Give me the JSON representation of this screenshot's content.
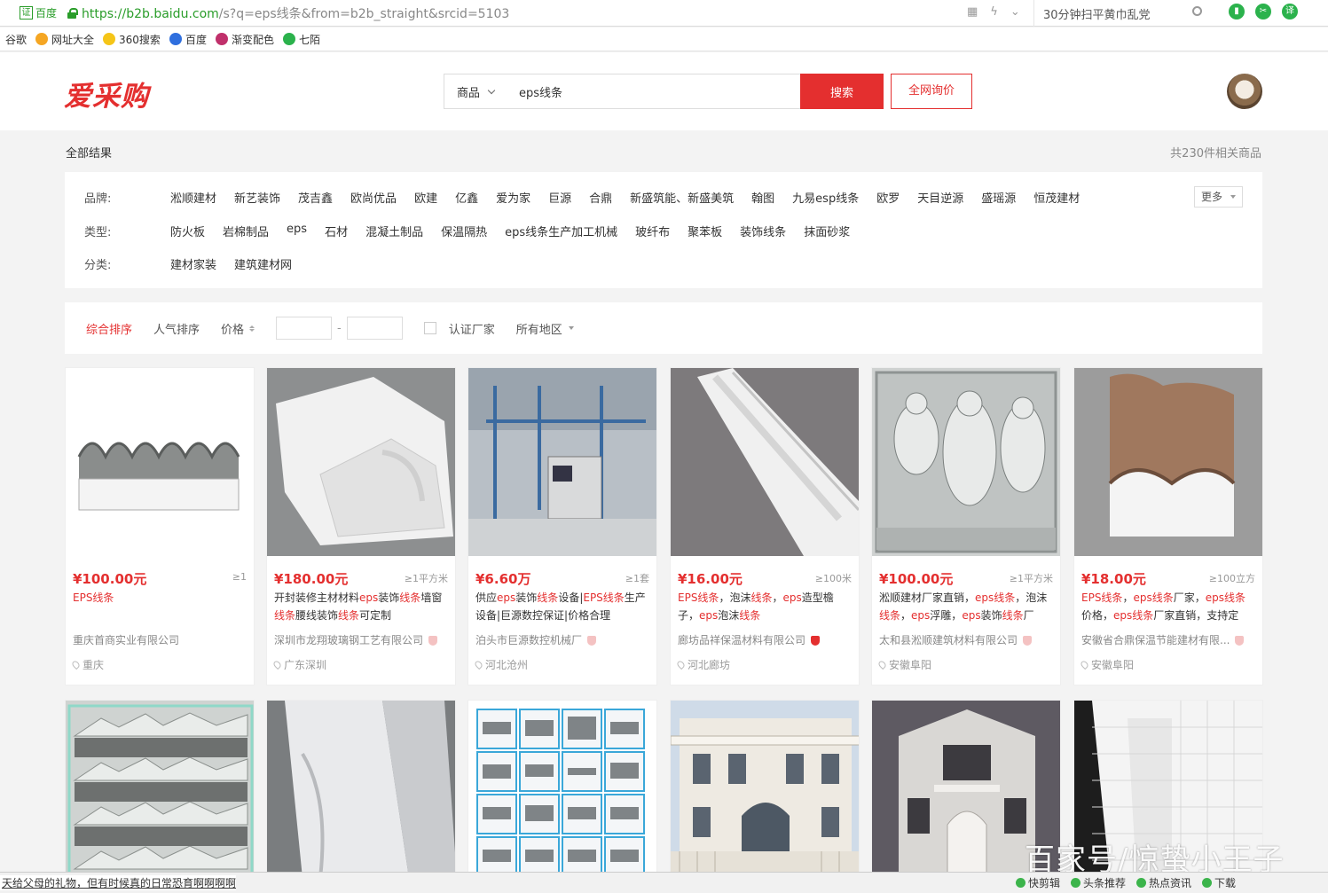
{
  "browser": {
    "cert_label": "百度",
    "cert_mark": "证",
    "url_domain": "https://b2b.baidu.com",
    "url_rest": "/s?q=eps线条&from=b2b_straight&srcid=5103",
    "addr_search_text": "30分钟扫平黄巾乱党",
    "chrome_icons": [
      "grid-icon",
      "bolt-icon",
      "chevron-down-icon"
    ],
    "ext_icons": [
      {
        "name": "reader-ext-icon",
        "color": "#2bb24c",
        "glyph": "▮"
      },
      {
        "name": "scissors-ext-icon",
        "color": "#2bb24c",
        "glyph": "✂"
      },
      {
        "name": "translate-ext-icon",
        "color": "#2bb24c",
        "glyph": "译"
      }
    ],
    "bookmarks": [
      {
        "label": "谷歌",
        "icon": "",
        "color": ""
      },
      {
        "label": "网址大全",
        "icon": "wangzhi-icon",
        "color": "#f5a623"
      },
      {
        "label": "360搜索",
        "icon": "360-icon",
        "color": "#f5c518"
      },
      {
        "label": "百度",
        "icon": "baidu-paw-icon",
        "color": "#2f6fde"
      },
      {
        "label": "渐变配色",
        "icon": "gradient-icon",
        "color": "#c0306b"
      },
      {
        "label": "七陌",
        "icon": "qimo-icon",
        "color": "#2bb24c"
      }
    ]
  },
  "header": {
    "logo": "爱采购",
    "search_category": "商品",
    "search_value": "eps线条",
    "search_button": "搜索",
    "inquiry_button": "全网询价",
    "accent": "#e42f2f"
  },
  "results": {
    "label": "全部结果",
    "count": "共230件相关商品"
  },
  "filters": {
    "brand_label": "品牌:",
    "brands": [
      "淞顺建材",
      "新艺装饰",
      "茂吉鑫",
      "欧尚优品",
      "欧建",
      "亿鑫",
      "爱为家",
      "巨源",
      "合鼎",
      "新盛筑能、新盛美筑",
      "翰图",
      "九易esp线条",
      "欧罗",
      "天目逆源",
      "盛瑶源",
      "恒茂建材"
    ],
    "more_label": "更多",
    "type_label": "类型:",
    "types": [
      "防火板",
      "岩棉制品",
      "eps",
      "石材",
      "混凝土制品",
      "保温隔热",
      "eps线条生产加工机械",
      "玻纤布",
      "聚苯板",
      "装饰线条",
      "抹面砂浆"
    ],
    "category_label": "分类:",
    "categories": [
      "建材家装",
      "建筑建材网"
    ]
  },
  "sort": {
    "comprehensive": "综合排序",
    "popularity": "人气排序",
    "price": "价格",
    "price_dash": "-",
    "certified": "认证厂家",
    "region": "所有地区"
  },
  "products": [
    {
      "price": "¥100.00元",
      "min": "≥1",
      "title_html": "<span class='hl'>EPS线条</span>",
      "company": "重庆首商实业有限公司",
      "badge": "",
      "location": "重庆",
      "pic": "wave"
    },
    {
      "price": "¥180.00元",
      "min": "≥1平方米",
      "title_html": "开封装修主材材料<span class='hl'>eps</span>装饰<span class='hl'>线条</span>墙窗<span class='hl'>线条</span>腰线装饰<span class='hl'>线条</span>可定制",
      "company": "深圳市龙翔玻璃钢工艺有限公司",
      "badge": "light",
      "location": "广东深圳",
      "pic": "foam"
    },
    {
      "price": "¥6.60万",
      "min": "≥1套",
      "title_html": "供应<span class='hl'>eps</span>装饰<span class='hl'>线条</span>设备|<span class='hl'>EPS线条</span>生产设备|巨源数控保证|价格合理",
      "company": "泊头市巨源数控机械厂",
      "badge": "light",
      "location": "河北沧州",
      "pic": "machine"
    },
    {
      "price": "¥16.00元",
      "min": "≥100米",
      "title_html": "<span class='hl'>EPS线条</span>，泡沫<span class='hl'>线条</span>，<span class='hl'>eps</span>造型檐子，<span class='hl'>eps</span>泡沫<span class='hl'>线条</span>",
      "company": "廊坊品祥保温材料有限公司",
      "badge": "strong",
      "location": "河北廊坊",
      "pic": "molding"
    },
    {
      "price": "¥100.00元",
      "min": "≥1平方米",
      "title_html": "淞顺建材厂家直销，<span class='hl'>eps线条</span>，泡沫<span class='hl'>线条</span>，<span class='hl'>eps</span>浮雕，<span class='hl'>eps</span>装饰<span class='hl'>线条</span>厂家...",
      "company": "太和县淞顺建筑材料有限公司",
      "badge": "light",
      "location": "安徽阜阳",
      "pic": "relief"
    },
    {
      "price": "¥18.00元",
      "min": "≥100立方",
      "title_html": "<span class='hl'>EPS线条</span>，<span class='hl'>eps线条</span>厂家，<span class='hl'>eps线条</span>价格，<span class='hl'>eps线条</span>厂家直销，支持定制...",
      "company": "安徽省合鼎保温节能建材有限...",
      "badge": "light",
      "location": "安徽阜阳",
      "pic": "crown"
    }
  ],
  "status": {
    "text": "天给父母的礼物，但有时候真的日常恐育啊啊啊啊",
    "items": [
      "快剪辑",
      "头条推荐",
      "热点资讯",
      "下载"
    ]
  },
  "watermark": "百家号/惊蛰小王子"
}
